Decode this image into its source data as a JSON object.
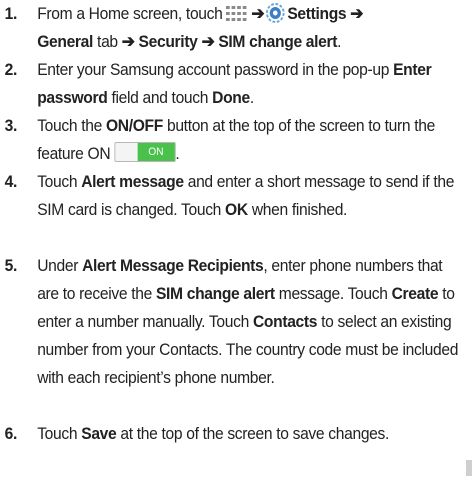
{
  "steps": [
    {
      "number": "1.",
      "parts": {
        "a": "From a Home screen, touch",
        "arrow1": "➔",
        "settings": "Settings",
        "arrow2": "➔",
        "general": "General",
        "tab": " tab ",
        "arrow3": "➔",
        "security": "Security",
        "arrow4": "➔",
        "sim_alert": "SIM change alert",
        "end": "."
      },
      "icons": [
        "apps-grid-icon",
        "settings-gear-icon"
      ]
    },
    {
      "number": "2.",
      "parts": {
        "a": "Enter your Samsung account password in the pop-up ",
        "field": "Enter password",
        "b": " field and touch ",
        "done": "Done",
        "end": "."
      }
    },
    {
      "number": "3.",
      "parts": {
        "a": "Touch the ",
        "onoff": "ON/OFF",
        "b": " button at the top of the screen to turn the feature ON",
        "end": "."
      },
      "toggle_label": "ON",
      "toggle_color": "#49c14a"
    },
    {
      "number": "4.",
      "parts": {
        "a": "Touch ",
        "alert": "Alert message",
        "b": " and enter a short message to send if the SIM card is changed. Touch ",
        "ok": "OK",
        "c": " when finished."
      }
    },
    {
      "number": "5.",
      "parts": {
        "a": "Under ",
        "recipients": "Alert Message Recipients",
        "b": ", enter phone numbers that are to receive the ",
        "sim_alert": "SIM change alert",
        "c": " message. Touch ",
        "create": "Create",
        "d": " to enter a number manually. Touch ",
        "contacts": "Contacts",
        "e": " to select an existing number from your Contacts. The country code must be included with each recipient’s phone number."
      }
    },
    {
      "number": "6.",
      "parts": {
        "a": "Touch ",
        "save": "Save",
        "b": " at the top of the screen to save changes."
      }
    }
  ]
}
